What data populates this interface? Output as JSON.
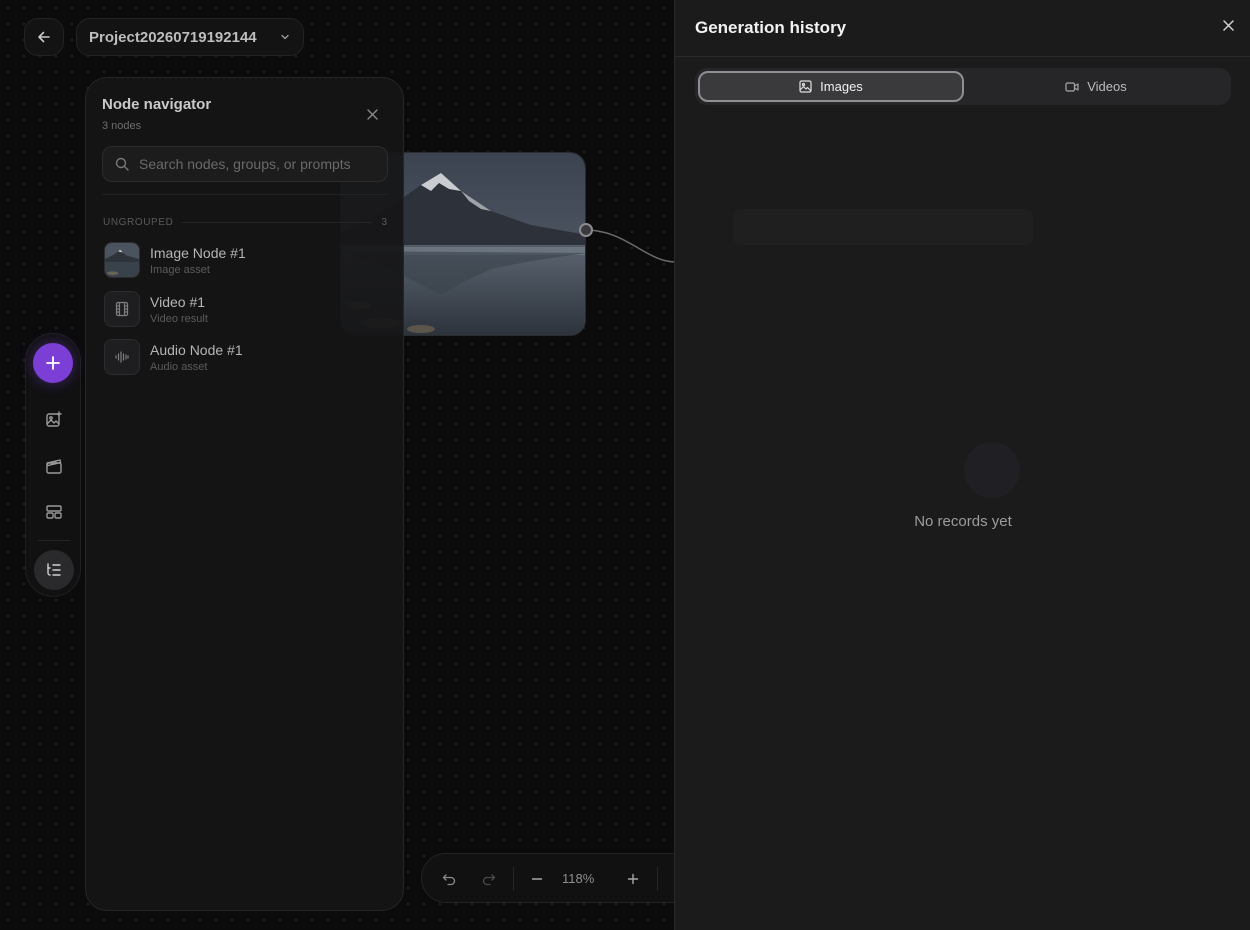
{
  "header": {
    "project_name": "Project20260719192144"
  },
  "navigator": {
    "title": "Node navigator",
    "node_count": "3 nodes",
    "search_placeholder": "Search nodes, groups, or prompts",
    "group": {
      "label": "UNGROUPED",
      "count": "3"
    },
    "items": [
      {
        "name": "Image Node #1",
        "type": "Image asset",
        "icon": "image-thumbnail"
      },
      {
        "name": "Video #1",
        "type": "Video result",
        "icon": "film-icon"
      },
      {
        "name": "Audio Node #1",
        "type": "Audio asset",
        "icon": "waveform-icon"
      }
    ]
  },
  "zoom": {
    "level": "118%"
  },
  "history": {
    "title": "Generation history",
    "tabs": [
      {
        "label": "Images",
        "icon": "image-icon",
        "active": true
      },
      {
        "label": "Videos",
        "icon": "video-camera-icon",
        "active": false
      }
    ],
    "empty_text": "No records yet"
  },
  "colors": {
    "accent": "#7b3fd6",
    "panel": "#1b1b1c",
    "canvas": "#0b0b0c"
  }
}
